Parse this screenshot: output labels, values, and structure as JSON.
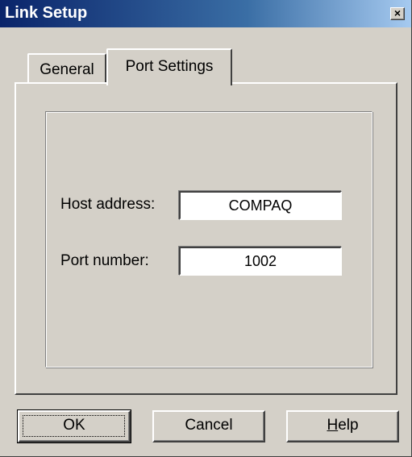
{
  "window": {
    "title": "Link Setup",
    "close_glyph": "×"
  },
  "tabs": [
    {
      "label": "General",
      "active": false
    },
    {
      "label": "Port Settings",
      "active": true
    }
  ],
  "fields": {
    "host_address": {
      "label": "Host address:",
      "value": "COMPAQ"
    },
    "port_number": {
      "label": "Port number:",
      "value": "1002"
    }
  },
  "buttons": {
    "ok_label": "OK",
    "cancel_label": "Cancel",
    "help_mnemonic": "H",
    "help_rest": "elp"
  },
  "icons": {
    "close": "close-icon"
  }
}
